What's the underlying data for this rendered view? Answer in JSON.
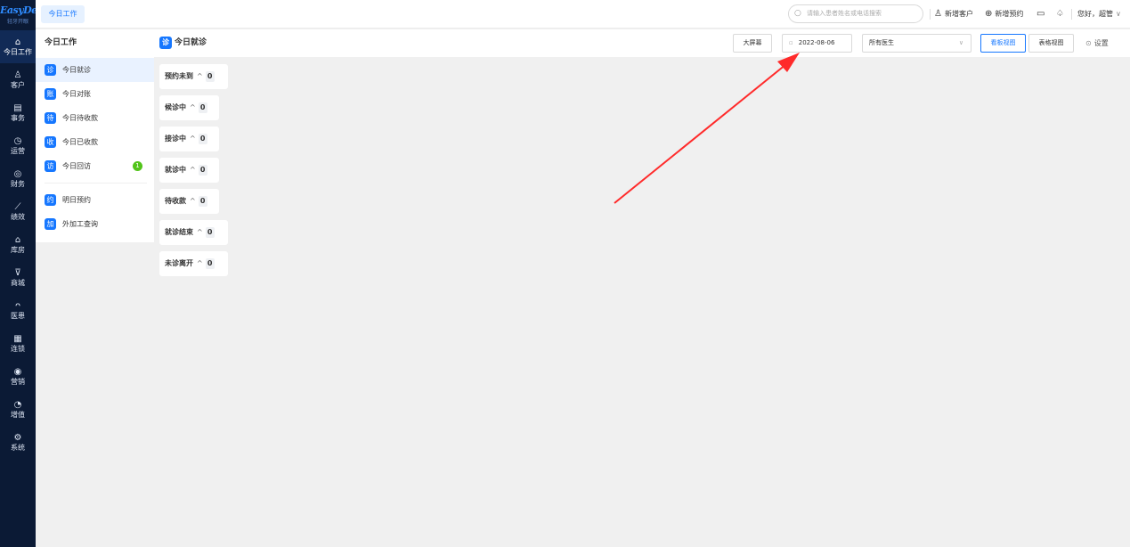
{
  "brand": {
    "logo": "EasyDent",
    "subtitle": "轻牙开眼"
  },
  "rail": [
    {
      "icon": "⌂",
      "label": "今日工作"
    },
    {
      "icon": "♙",
      "label": "客户"
    },
    {
      "icon": "▤",
      "label": "事务"
    },
    {
      "icon": "◷",
      "label": "运营"
    },
    {
      "icon": "◎",
      "label": "财务"
    },
    {
      "icon": "⟋",
      "label": "绩效"
    },
    {
      "icon": "⌂",
      "label": "库房"
    },
    {
      "icon": "⊽",
      "label": "商城"
    },
    {
      "icon": "ᴖ",
      "label": "医患"
    },
    {
      "icon": "▦",
      "label": "连锁"
    },
    {
      "icon": "◉",
      "label": "营销"
    },
    {
      "icon": "◔",
      "label": "增值"
    },
    {
      "icon": "⚙",
      "label": "系统"
    }
  ],
  "topbar": {
    "tab": "今日工作",
    "search_placeholder": "请输入患者姓名或电话搜索",
    "new_customer": "新增客户",
    "new_appointment": "新增预约",
    "greeting": "您好，超管"
  },
  "sidebar": {
    "title": "今日工作",
    "items": [
      {
        "icon": "诊",
        "label": "今日就诊"
      },
      {
        "icon": "账",
        "label": "今日对账"
      },
      {
        "icon": "待",
        "label": "今日待收款"
      },
      {
        "icon": "收",
        "label": "今日已收款"
      },
      {
        "icon": "访",
        "label": "今日回访",
        "badge": "1"
      },
      {
        "icon": "约",
        "label": "明日预约"
      },
      {
        "icon": "加",
        "label": "外加工查询"
      }
    ]
  },
  "panel": {
    "title": "今日就诊",
    "bigscreen": "大屏幕",
    "date": "2022-08-06",
    "doctor": "所有医生",
    "board_view": "看板视图",
    "table_view": "表格视图",
    "settings": "设置"
  },
  "columns": [
    {
      "label": "预约未到",
      "count": "0"
    },
    {
      "label": "候诊中",
      "count": "0"
    },
    {
      "label": "接诊中",
      "count": "0"
    },
    {
      "label": "就诊中",
      "count": "0"
    },
    {
      "label": "待收款",
      "count": "0"
    },
    {
      "label": "就诊结束",
      "count": "0"
    },
    {
      "label": "未诊离开",
      "count": "0"
    }
  ],
  "colors": {
    "accent": "#1677ff",
    "rail_bg": "#0b1a35",
    "badge": "#52c41a",
    "annotation_arrow": "#ff2a2a"
  }
}
